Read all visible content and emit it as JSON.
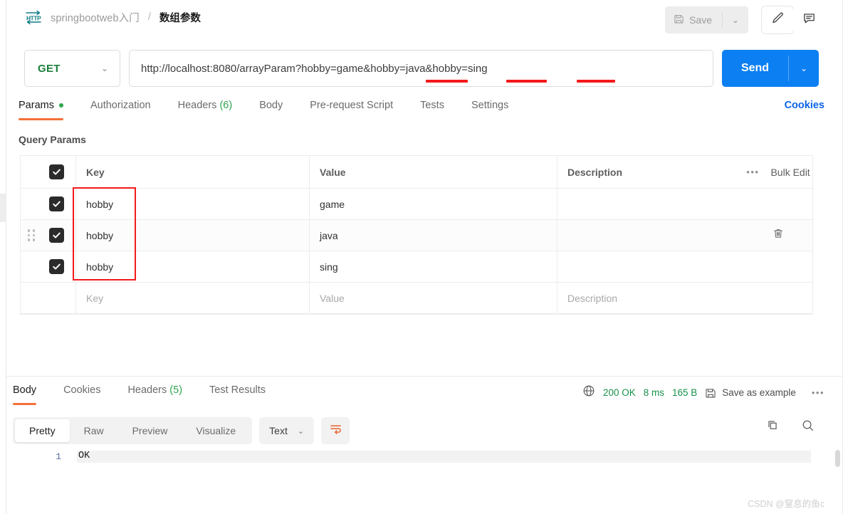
{
  "header": {
    "icon": "http-icon",
    "breadcrumb_folder": "springbootweb入门",
    "breadcrumb_sep": "/",
    "breadcrumb_name": "数组参数",
    "save_label": "Save",
    "save_caret": "⌄",
    "edit_icon": "pencil-icon",
    "comment_icon": "comment-icon"
  },
  "request": {
    "method": "GET",
    "method_caret": "⌄",
    "url": "http://localhost:8080/arrayParam?hobby=game&hobby=java&hobby=sing",
    "send_label": "Send",
    "send_caret": "⌄",
    "annotation_color": "#f41a1a"
  },
  "tabs": [
    {
      "label": "Params",
      "active": true,
      "dot": true
    },
    {
      "label": "Authorization",
      "active": false
    },
    {
      "label": "Headers",
      "count": "(6)",
      "active": false
    },
    {
      "label": "Body",
      "active": false
    },
    {
      "label": "Pre-request Script",
      "active": false
    },
    {
      "label": "Tests",
      "active": false
    },
    {
      "label": "Settings",
      "active": false
    }
  ],
  "cookies_link": "Cookies",
  "query_params": {
    "title": "Query Params",
    "columns": {
      "key": "Key",
      "value": "Value",
      "description": "Description"
    },
    "bulk_edit": "Bulk Edit",
    "more_icon": "ellipsis-icon",
    "rows": [
      {
        "checked": true,
        "key": "hobby",
        "value": "game",
        "description": ""
      },
      {
        "checked": true,
        "key": "hobby",
        "value": "java",
        "description": "",
        "hovered": true,
        "delete_icon": "trash-icon"
      },
      {
        "checked": true,
        "key": "hobby",
        "value": "sing",
        "description": ""
      }
    ],
    "placeholder_row": {
      "key": "Key",
      "value": "Value",
      "description": "Description"
    }
  },
  "response": {
    "tabs": [
      {
        "label": "Body",
        "active": true
      },
      {
        "label": "Cookies",
        "active": false
      },
      {
        "label": "Headers",
        "count": "(5)",
        "active": false
      },
      {
        "label": "Test Results",
        "active": false
      }
    ],
    "globe_icon": "globe-icon",
    "status": "200 OK",
    "time": "8 ms",
    "size": "165 B",
    "save_example_icon": "save-icon",
    "save_example": "Save as example",
    "more_icon": "ellipsis-icon",
    "view_modes": [
      {
        "label": "Pretty",
        "active": true
      },
      {
        "label": "Raw",
        "active": false
      },
      {
        "label": "Preview",
        "active": false
      },
      {
        "label": "Visualize",
        "active": false
      }
    ],
    "format": "Text",
    "format_caret": "⌄",
    "wrap_icon": "wrap-lines-icon",
    "copy_icon": "copy-icon",
    "search_icon": "search-icon",
    "body_lines": [
      {
        "num": "1",
        "text": "OK"
      }
    ]
  },
  "watermark": "CSDN @窒息的鱼c"
}
